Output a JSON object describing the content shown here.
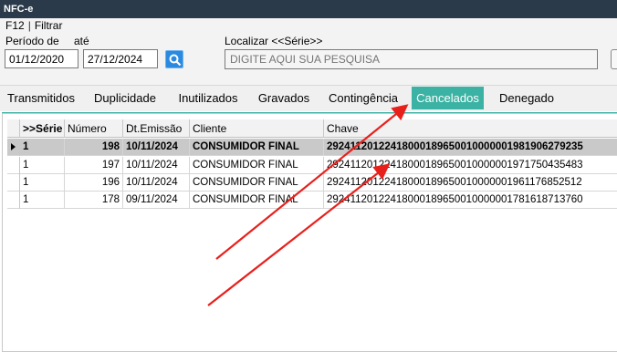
{
  "window": {
    "title": "NFC-e"
  },
  "menu": {
    "shortcut": "F12",
    "separator": "|",
    "filter_label": "Filtrar"
  },
  "filter": {
    "period_label": "Período de",
    "to_label": "até",
    "date_from": "01/12/2020",
    "date_to": "27/12/2024",
    "search_label": "Localizar <<Série>>",
    "search_placeholder": "DIGITE AQUI SUA PESQUISA"
  },
  "tabs": [
    {
      "label": "Transmitidos"
    },
    {
      "label": "Duplicidade"
    },
    {
      "label": "Inutilizados"
    },
    {
      "label": "Gravados"
    },
    {
      "label": "Contingência"
    },
    {
      "label": "Cancelados"
    },
    {
      "label": "Denegado"
    }
  ],
  "active_tab": "Cancelados",
  "accent_color": "#3bb2a3",
  "grid": {
    "columns": [
      ">>Série",
      "Número",
      "Dt.Emissão",
      "Cliente",
      "Chave"
    ],
    "rows": [
      {
        "serie": "1",
        "numero": "198",
        "data": "10/11/2024",
        "cliente": "CONSUMIDOR FINAL",
        "chave": "29241120122418000189650010000001981906279235"
      },
      {
        "serie": "1",
        "numero": "197",
        "data": "10/11/2024",
        "cliente": "CONSUMIDOR FINAL",
        "chave": "29241120122418000189650010000001971750435483"
      },
      {
        "serie": "1",
        "numero": "196",
        "data": "10/11/2024",
        "cliente": "CONSUMIDOR FINAL",
        "chave": "29241120122418000189650010000001961176852512"
      },
      {
        "serie": "1",
        "numero": "178",
        "data": "09/11/2024",
        "cliente": "CONSUMIDOR FINAL",
        "chave": "29241120122418000189650010000001781618713760"
      }
    ]
  },
  "annotation_color": "#e8201c"
}
